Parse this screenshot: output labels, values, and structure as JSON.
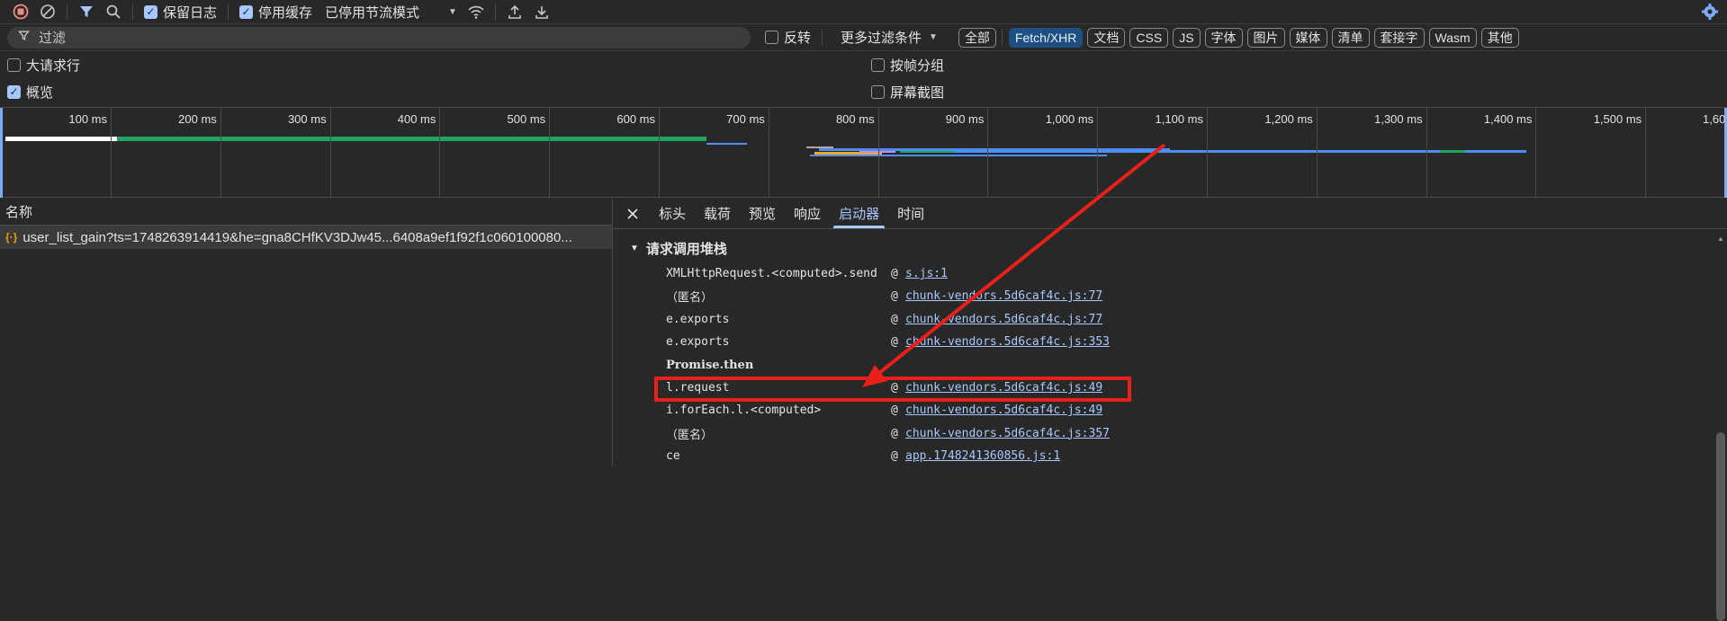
{
  "toolbar": {
    "preserve_log": "保留日志",
    "disable_cache": "停用缓存",
    "throttle": "已停用节流模式"
  },
  "filterbar": {
    "filter_placeholder": "过滤",
    "invert": "反转",
    "more_filters": "更多过滤条件",
    "type_filters": [
      "全部",
      "Fetch/XHR",
      "文档",
      "CSS",
      "JS",
      "字体",
      "图片",
      "媒体",
      "清单",
      "套接字",
      "Wasm",
      "其他"
    ],
    "active_filter": "Fetch/XHR"
  },
  "options": {
    "big_rows": "大请求行",
    "overview": "概览",
    "group_by_frame": "按帧分组",
    "screenshots": "屏幕截图"
  },
  "timeline": {
    "ticks": [
      "100 ms",
      "200 ms",
      "300 ms",
      "400 ms",
      "500 ms",
      "600 ms",
      "700 ms",
      "800 ms",
      "900 ms",
      "1,000 ms",
      "1,100 ms",
      "1,200 ms",
      "1,300 ms",
      "1,400 ms",
      "1,500 ms",
      "1,60"
    ]
  },
  "requests": {
    "column_name": "名称",
    "rows": [
      {
        "name": "user_list_gain?ts=1748263914419&he=gna8CHfKV3DJw45...6408a9ef1f92f1c060100080..."
      }
    ]
  },
  "details": {
    "tabs": [
      "标头",
      "载荷",
      "预览",
      "响应",
      "启动器",
      "时间"
    ],
    "active_tab": "启动器",
    "section_title": "请求调用堆栈",
    "frames": [
      {
        "fn": "XMLHttpRequest.<computed>.send",
        "at": "@",
        "loc": "s.js:1"
      },
      {
        "fn": "（匿名）",
        "at": "@",
        "loc": "chunk-vendors.5d6caf4c.js:77"
      },
      {
        "fn": "e.exports",
        "at": "@",
        "loc": "chunk-vendors.5d6caf4c.js:77"
      },
      {
        "fn": "e.exports",
        "at": "@",
        "loc": "chunk-vendors.5d6caf4c.js:353"
      },
      {
        "fn": "Promise.then",
        "at": "",
        "loc": ""
      },
      {
        "fn": "l.request",
        "at": "@",
        "loc": "chunk-vendors.5d6caf4c.js:49"
      },
      {
        "fn": "i.forEach.l.<computed>",
        "at": "@",
        "loc": "chunk-vendors.5d6caf4c.js:49"
      },
      {
        "fn": "（匿名）",
        "at": "@",
        "loc": "chunk-vendors.5d6caf4c.js:357"
      },
      {
        "fn": "ce",
        "at": "@",
        "loc": "app.1748241360856.js:1"
      }
    ]
  },
  "colors": {
    "accent": "#a8c7fa",
    "annotation": "#e8201a",
    "bar_green": "#1fa463",
    "bar_blue": "#4c8df6"
  }
}
